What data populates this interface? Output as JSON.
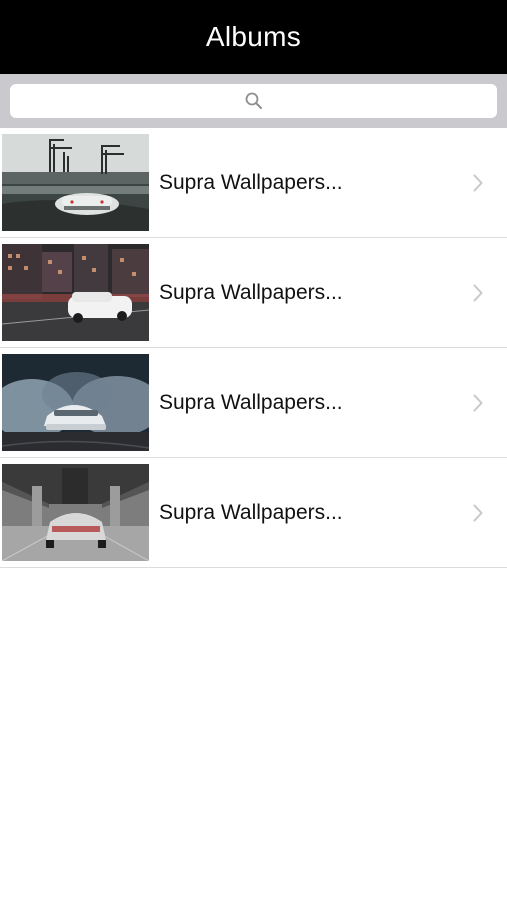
{
  "header": {
    "title": "Albums"
  },
  "search": {
    "icon": "search-icon"
  },
  "albums": [
    {
      "label": "Supra Wallpapers...",
      "thumbnail": "harbor-cranes-white-car"
    },
    {
      "label": "Supra Wallpapers...",
      "thumbnail": "city-night-white-car"
    },
    {
      "label": "Supra Wallpapers...",
      "thumbnail": "tire-smoke-white-car"
    },
    {
      "label": "Supra Wallpapers...",
      "thumbnail": "under-bridge-white-car"
    }
  ],
  "colors": {
    "navbar": "#000000",
    "search_bar_bg": "#c9c9ce",
    "separator": "#dcdcdc",
    "chevron": "#c7c7cc"
  }
}
